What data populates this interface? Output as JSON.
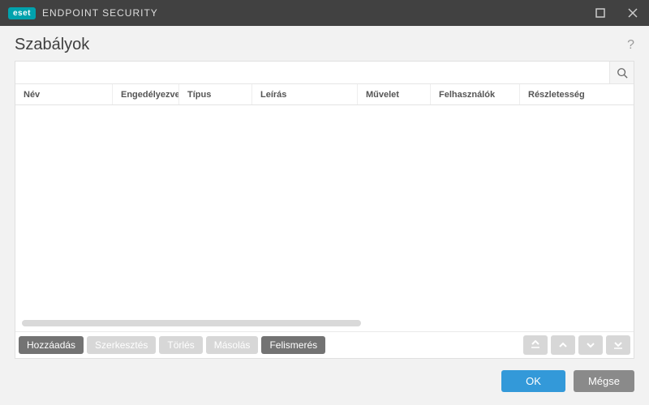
{
  "window": {
    "brand": "eset",
    "title": "ENDPOINT SECURITY"
  },
  "page": {
    "title": "Szabályok"
  },
  "search": {
    "placeholder": ""
  },
  "table": {
    "headers": {
      "name": "Név",
      "enabled": "Engedélyezve",
      "type": "Típus",
      "description": "Leírás",
      "action": "Művelet",
      "users": "Felhasználók",
      "verbosity": "Részletesség"
    },
    "rows": []
  },
  "actions": {
    "add": "Hozzáadás",
    "edit": "Szerkesztés",
    "delete": "Törlés",
    "copy": "Másolás",
    "recognition": "Felismerés"
  },
  "footer": {
    "ok": "OK",
    "cancel": "Mégse"
  }
}
